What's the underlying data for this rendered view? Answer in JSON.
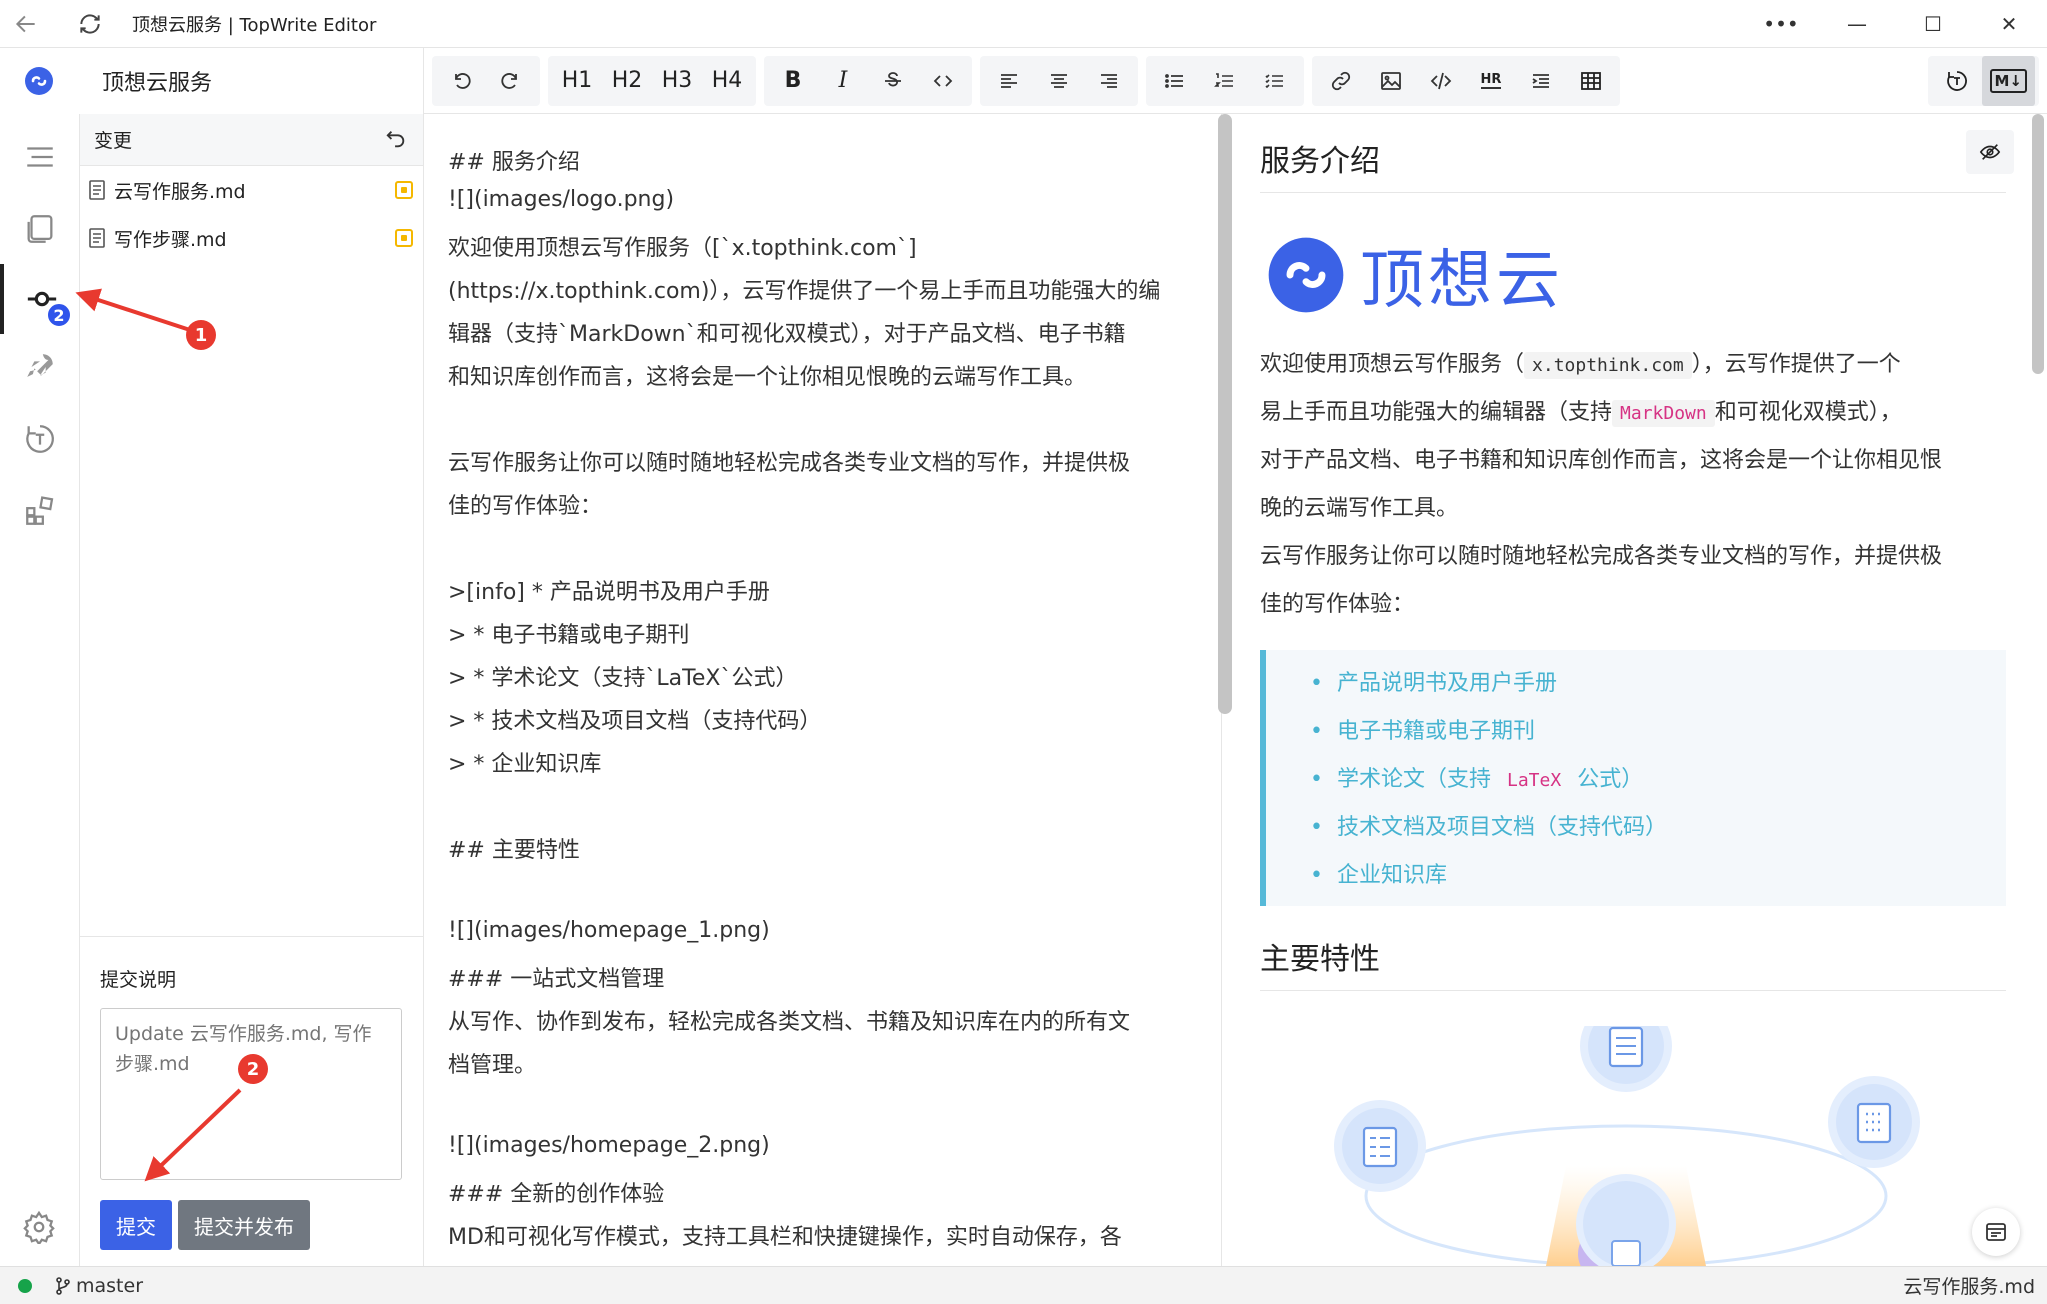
{
  "window": {
    "title": "顶想云服务 | TopWrite Editor"
  },
  "app": {
    "name": "顶想云服务"
  },
  "toolbar": {
    "h1": "H1",
    "h2": "H2",
    "h3": "H3",
    "h4": "H4",
    "bold": "B",
    "italic": "I",
    "hr": "HR",
    "md": "M↓"
  },
  "sidebar": {
    "header": "变更",
    "badge_count": "2",
    "files": [
      {
        "name": "云写作服务.md",
        "status": "modified"
      },
      {
        "name": "写作步骤.md",
        "status": "modified"
      }
    ],
    "commit": {
      "label": "提交说明",
      "placeholder": "Update 云写作服务.md, 写作步骤.md",
      "commit_button": "提交",
      "commit_publish_button": "提交并发布"
    }
  },
  "editor": {
    "lines": [
      "## 服务介绍",
      "![](images/logo.png)",
      "欢迎使用顶想云写作服务（[`x.topthink.com`]",
      "(https://x.topthink.com)），云写作提供了一个易上手而且功能强大的编",
      "辑器（支持`MarkDown`和可视化双模式），对于产品文档、电子书籍",
      "和知识库创作而言，这将会是一个让你相见恨晚的云端写作工具。",
      "",
      "云写作服务让你可以随时随地轻松完成各类专业文档的写作，并提供极",
      "佳的写作体验：",
      "",
      ">[info] * 产品说明书及用户手册",
      "> * 电子书籍或电子期刊",
      "> * 学术论文（支持`LaTeX`公式）",
      "> * 技术文档及项目文档（支持代码）",
      "> * 企业知识库",
      "",
      "## 主要特性",
      "",
      "![](images/homepage_1.png)",
      "### 一站式文档管理",
      "从写作、协作到发布，轻松完成各类文档、书籍及知识库在内的所有文",
      "档管理。",
      "",
      "![](images/homepage_2.png)",
      "### 全新的创作体验",
      "MD和可视化写作模式，支持工具栏和快捷键操作，实时自动保存，各"
    ]
  },
  "preview": {
    "heading1": "服务介绍",
    "logo_text": "顶想云",
    "p1_a": "欢迎使用顶想云写作服务（",
    "p1_code": "x.topthink.com",
    "p1_b": "），云写作提供了一个",
    "p2_a": "易上手而且功能强大的编辑器（支持",
    "p2_code": "MarkDown",
    "p2_b": "和可视化双模式），",
    "p3": "对于产品文档、电子书籍和知识库创作而言，这将会是一个让你相见恨",
    "p4": "晚的云端写作工具。",
    "p5": "云写作服务让你可以随时随地轻松完成各类专业文档的写作，并提供极",
    "p6": "佳的写作体验：",
    "quote_items": [
      "产品说明书及用户手册",
      "电子书籍或电子期刊",
      "学术论文（支持",
      "技术文档及项目文档（支持代码）",
      "企业知识库"
    ],
    "quote_code": "LaTeX",
    "quote_code_suffix": "公式）",
    "heading2": "主要特性"
  },
  "statusbar": {
    "branch": "master",
    "current_file": "云写作服务.md"
  },
  "annotations": {
    "marker1": "1",
    "marker2": "2"
  },
  "colors": {
    "accent": "#3b62e6",
    "badge": "#2f54eb",
    "modified": "#f5b800",
    "annotation": "#e8392f",
    "quote_text": "#47b3d1"
  }
}
